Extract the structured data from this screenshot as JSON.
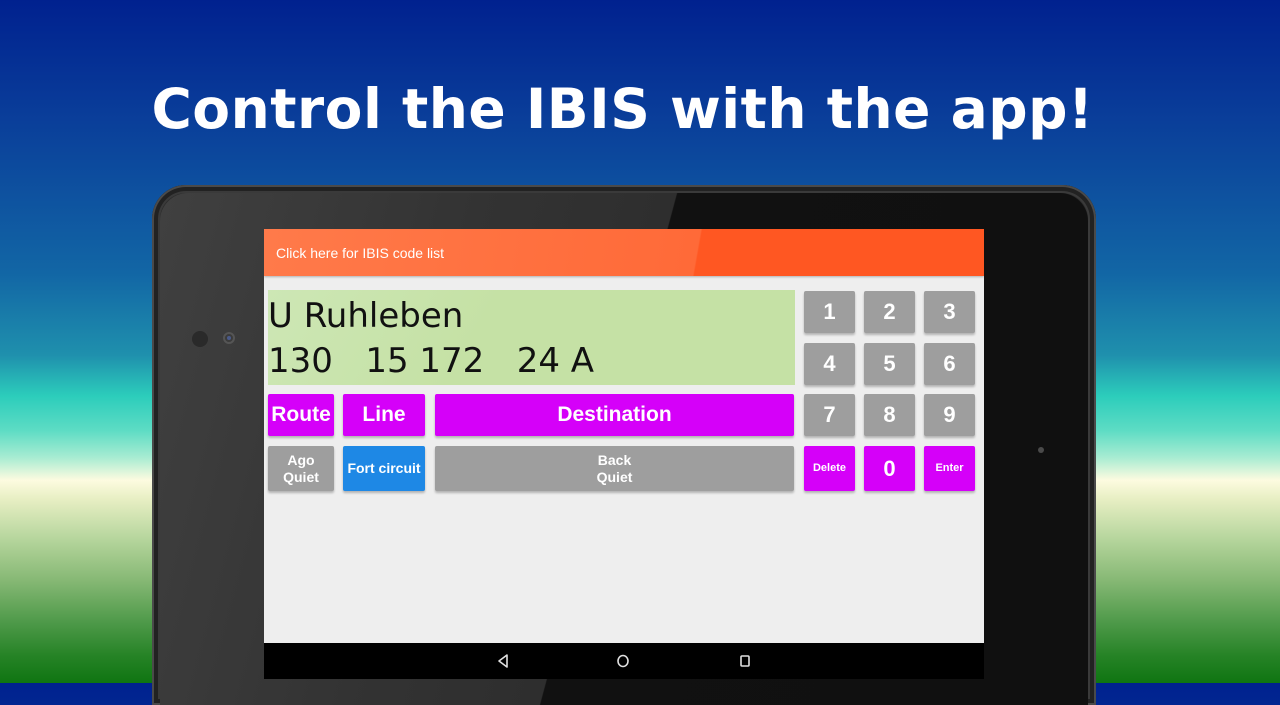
{
  "headline": "Control the IBIS with the app!",
  "app": {
    "header_link": "Click here for IBIS code list",
    "display": {
      "destination": "U Ruhleben",
      "codes": "130   15 172   24 A"
    },
    "buttons": {
      "route": "Route",
      "line": "Line",
      "destination": "Destination",
      "ago_quiet_1": "Ago",
      "ago_quiet_2": "Quiet",
      "fort_circuit": "Fort circuit",
      "back_quiet_1": "Back",
      "back_quiet_2": "Quiet"
    },
    "keypad": {
      "k1": "1",
      "k2": "2",
      "k3": "3",
      "k4": "4",
      "k5": "5",
      "k6": "6",
      "k7": "7",
      "k8": "8",
      "k9": "9",
      "delete": "Delete",
      "k0": "0",
      "enter": "Enter"
    }
  },
  "navbar": {
    "icons": [
      "back-icon",
      "home-icon",
      "recents-icon"
    ]
  },
  "colors": {
    "appbar": "#ff5722",
    "display_bg": "#c5e1a5",
    "magenta": "#d500f9",
    "gray": "#9e9e9e",
    "blue": "#1e88e5"
  }
}
